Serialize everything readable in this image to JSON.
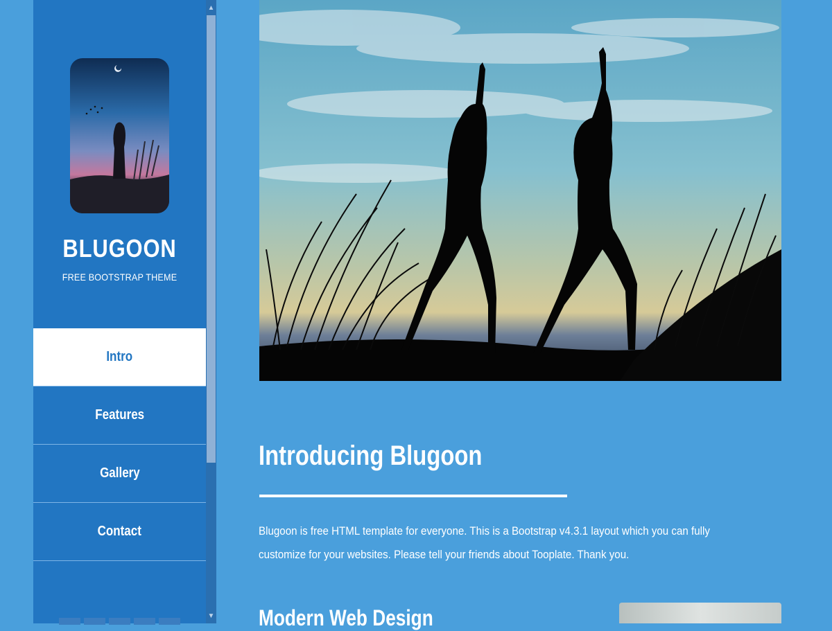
{
  "sidebar": {
    "brand_title": "BLUGOON",
    "brand_tagline": "FREE BOOTSTRAP THEME",
    "nav": [
      {
        "label": "Intro",
        "active": true
      },
      {
        "label": "Features",
        "active": false
      },
      {
        "label": "Gallery",
        "active": false
      },
      {
        "label": "Contact",
        "active": false
      }
    ]
  },
  "main": {
    "section_title": "Introducing Blugoon",
    "intro_text": "Blugoon is free HTML template for everyone. This is a Bootstrap v4.3.1 layout which you can fully customize for your websites. Please tell your friends about Tooplate. Thank you.",
    "next_section_title": "Modern Web Design"
  },
  "colors": {
    "page_bg": "#4a9fdc",
    "sidebar_bg": "#2276c2",
    "active_nav_bg": "#ffffff"
  }
}
